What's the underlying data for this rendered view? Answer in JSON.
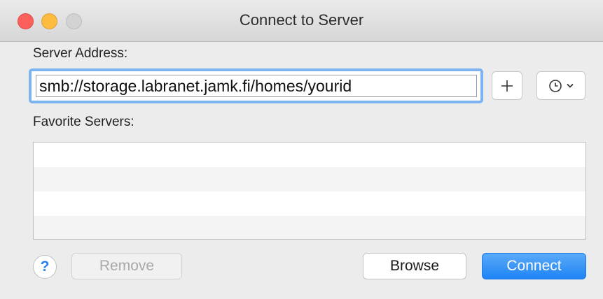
{
  "window": {
    "title": "Connect to Server",
    "traffic_lights": {
      "close_color": "#fc605c",
      "minimize_color": "#fdbc40",
      "zoom_color": "#d3d3d3"
    }
  },
  "server_address": {
    "label": "Server Address:",
    "value": "smb://storage.labranet.jamk.fi/homes/yourid",
    "add_icon": "plus-icon",
    "recent_icon": "clock-icon",
    "recent_dropdown_icon": "chevron-down-icon"
  },
  "favorites": {
    "label": "Favorite Servers:",
    "items": []
  },
  "footer": {
    "help_label": "?",
    "remove_label": "Remove",
    "browse_label": "Browse",
    "connect_label": "Connect"
  },
  "colors": {
    "accent": "#1e84f5",
    "focus_ring": "#7db4f0"
  }
}
